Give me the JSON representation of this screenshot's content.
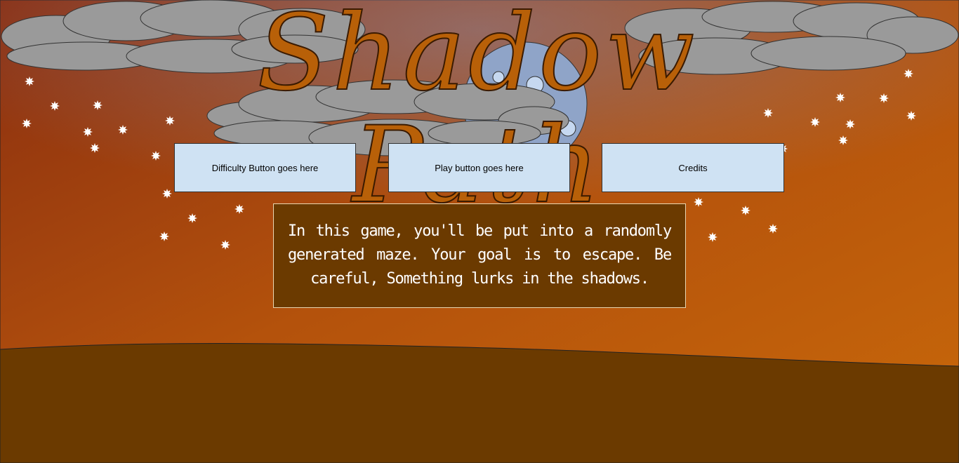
{
  "title": "Shadow Path",
  "buttons": {
    "difficulty": "Difficulty Button goes here",
    "play": "Play button goes here",
    "credits": "Credits"
  },
  "description": "In this game, you'll be put into a randomly generated maze. Your goal is to escape. Be careful, Something lurks in the shadows.",
  "colors": {
    "sky_top": "#8a3010",
    "sky_bottom": "#c8640a",
    "ground": "#6b3a00",
    "cloud": "#9a9a9a",
    "moon": "#8fa4c8",
    "title": "#b86008",
    "button": "#cfe2f3"
  }
}
